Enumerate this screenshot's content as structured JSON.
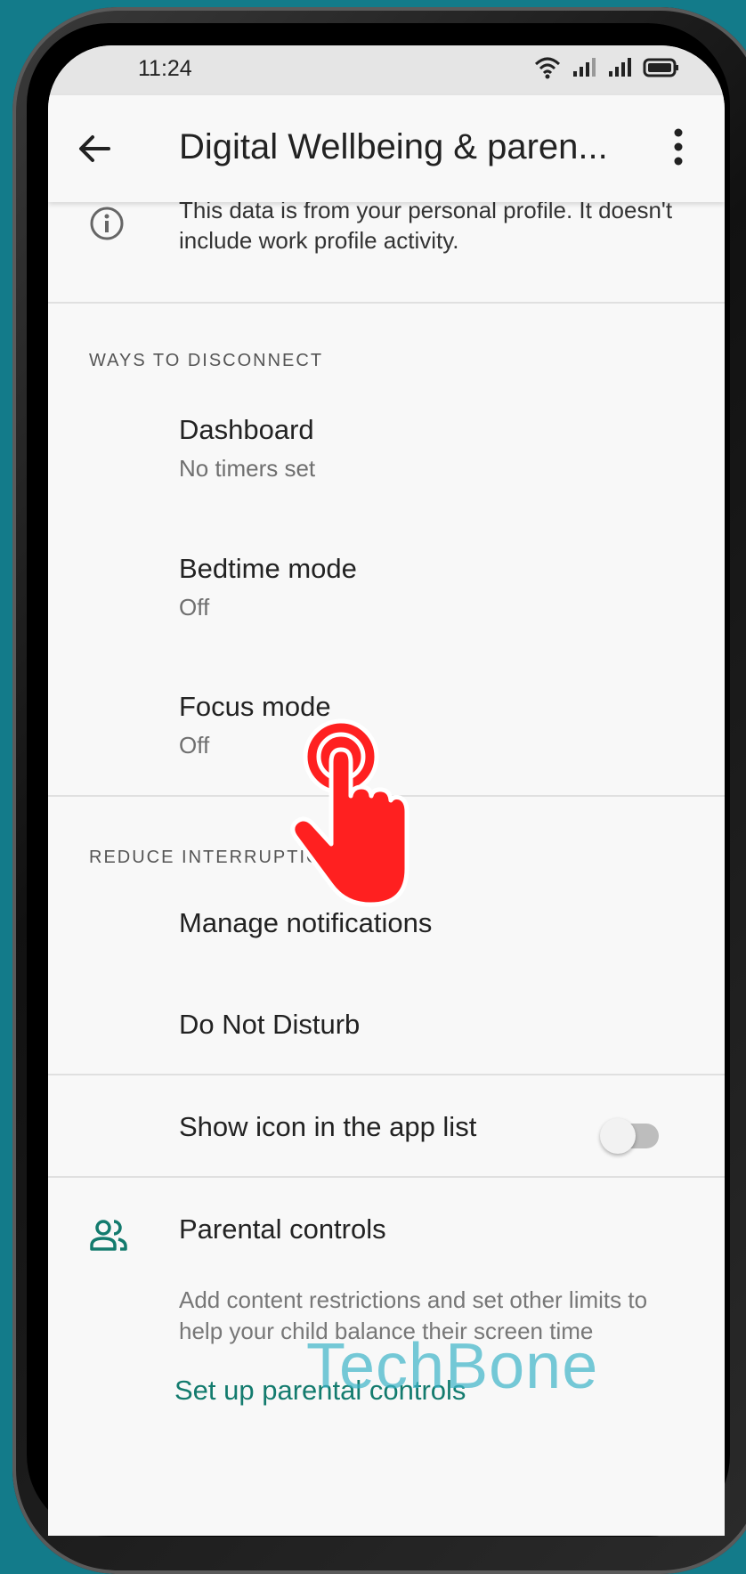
{
  "status_bar": {
    "time": "11:24"
  },
  "app_bar": {
    "title": "Digital Wellbeing & paren..."
  },
  "info": {
    "text": "This data is from your personal profile. It doesn't include work profile activity."
  },
  "ways_to_disconnect": {
    "header": "WAYS TO DISCONNECT",
    "items": [
      {
        "title": "Dashboard",
        "subtitle": "No timers set"
      },
      {
        "title": "Bedtime mode",
        "subtitle": "Off"
      },
      {
        "title": "Focus mode",
        "subtitle": "Off"
      }
    ]
  },
  "reduce_interruptions": {
    "header": "REDUCE INTERRUPTIONS",
    "items": [
      {
        "title": "Manage notifications"
      },
      {
        "title": "Do Not Disturb"
      }
    ]
  },
  "show_icon": {
    "title": "Show icon in the app list",
    "enabled": false
  },
  "parental_controls": {
    "title": "Parental controls",
    "description": "Add content restrictions and set other limits to help your child balance their screen time",
    "link": "Set up parental controls"
  },
  "watermark": "TechBone",
  "colors": {
    "background": "#137b8a",
    "accent": "#137b6e",
    "pointer": "#ff2020"
  }
}
